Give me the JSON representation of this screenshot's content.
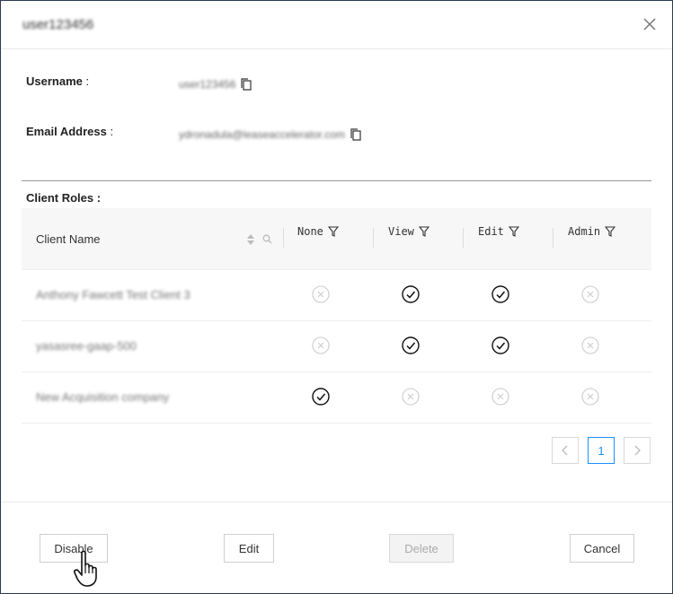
{
  "header": {
    "title": "user123456",
    "close_icon": "close-icon"
  },
  "fields": {
    "username_label": "Username",
    "username_value": "user123456",
    "email_label": "Email Address",
    "email_value": "ydronadula@leaseaccelerator.com",
    "colon": ":"
  },
  "roles": {
    "label": "Client Roles :",
    "columns": {
      "name": "Client Name",
      "none": "None",
      "view": "View",
      "edit": "Edit",
      "admin": "Admin"
    },
    "rows": [
      {
        "name": "Anthony Fawcett Test Client 3",
        "none": false,
        "view": true,
        "edit": true,
        "admin": false
      },
      {
        "name": "yasasree-gaap-500",
        "none": false,
        "view": true,
        "edit": true,
        "admin": false
      },
      {
        "name": "New Acquisition company",
        "none": true,
        "view": false,
        "edit": false,
        "admin": false
      }
    ]
  },
  "pagination": {
    "current_page": "1",
    "prev_icon": "chevron-left-icon",
    "next_icon": "chevron-right-icon"
  },
  "footer": {
    "disable_label": "Disable",
    "edit_label": "Edit",
    "delete_label": "Delete",
    "cancel_label": "Cancel"
  },
  "colors": {
    "border": "#2b3a55",
    "accent": "#1890ff",
    "check": "#111111",
    "inactive": "#cccccc"
  }
}
